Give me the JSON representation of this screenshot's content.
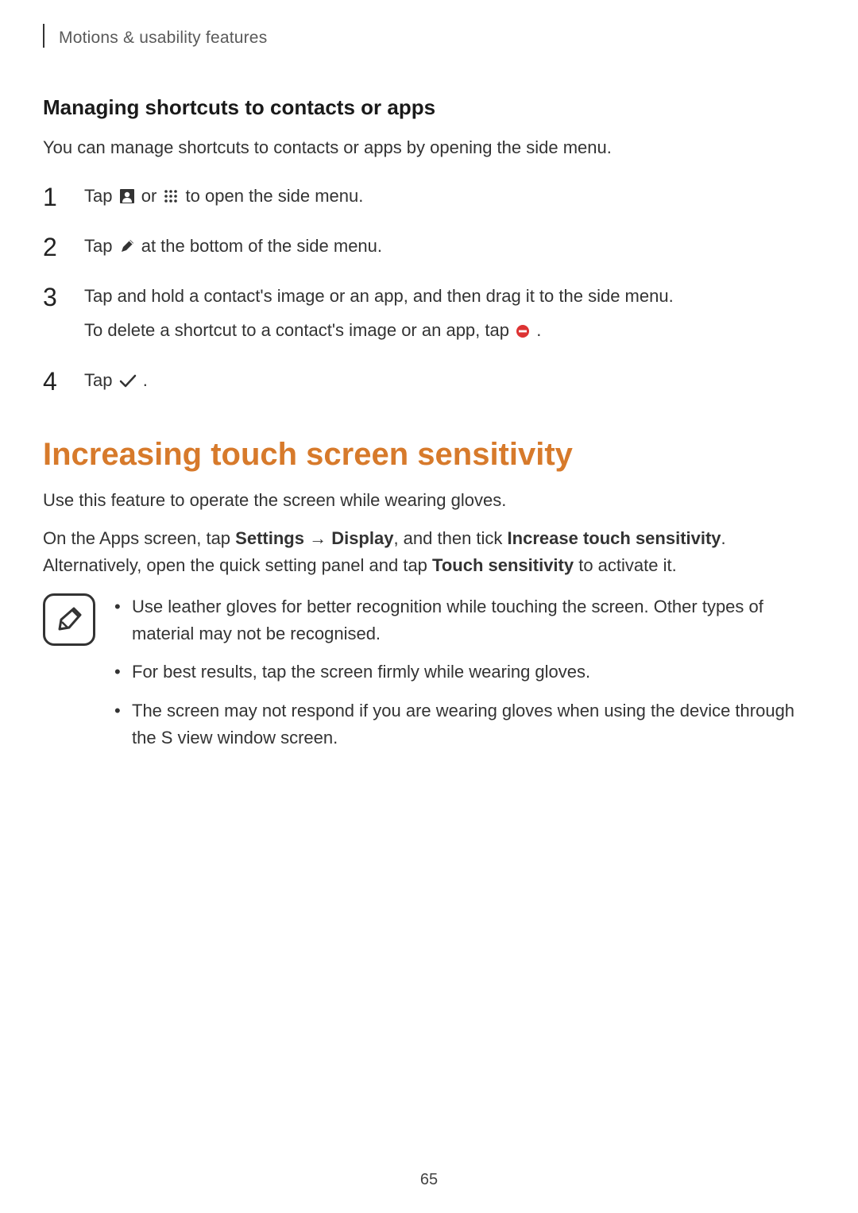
{
  "header": {
    "chapter": "Motions & usability features"
  },
  "section1": {
    "heading": "Managing shortcuts to contacts or apps",
    "intro": "You can manage shortcuts to contacts or apps by opening the side menu.",
    "steps": {
      "s1": {
        "t1": "Tap ",
        "t2": " or ",
        "t3": " to open the side menu."
      },
      "s2": {
        "t1": "Tap ",
        "t2": " at the bottom of the side menu."
      },
      "s3": {
        "line": "Tap and hold a contact's image or an app, and then drag it to the side menu.",
        "sub_t1": "To delete a shortcut to a contact's image or an app, tap ",
        "sub_t2": "."
      },
      "s4": {
        "t1": "Tap ",
        "t2": "."
      }
    }
  },
  "section2": {
    "title": "Increasing touch screen sensitivity",
    "p1": "Use this feature to operate the screen while wearing gloves.",
    "p2": {
      "a": "On the Apps screen, tap ",
      "b_bold": "Settings",
      "arrow": " → ",
      "c_bold": "Display",
      "d": ", and then tick ",
      "e_bold": "Increase touch sensitivity",
      "f": ". Alternatively, open the quick setting panel and tap ",
      "g_bold": "Touch sensitivity",
      "h": " to activate it."
    },
    "notes": {
      "n1": "Use leather gloves for better recognition while touching the screen. Other types of material may not be recognised.",
      "n2": "For best results, tap the screen firmly while wearing gloves.",
      "n3": "The screen may not respond if you are wearing gloves when using the device through the S view window screen."
    }
  },
  "page_number": "65"
}
